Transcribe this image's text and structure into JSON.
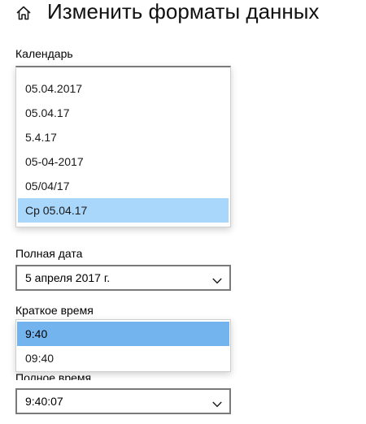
{
  "header": {
    "title": "Изменить форматы данных",
    "home_icon": "home-icon"
  },
  "calendar": {
    "label": "Календарь",
    "options": [
      "05.04.2017",
      "05.04.17",
      "5.4.17",
      "05-04-2017",
      "05/04/17",
      "Ср 05.04.17"
    ],
    "selected_index": 5
  },
  "long_date": {
    "label": "Полная дата",
    "value": "5 апреля 2017 г.",
    "icon": "chevron-down-icon"
  },
  "short_time": {
    "label": "Краткое время",
    "options": [
      "9:40",
      "09:40"
    ],
    "selected_index": 0
  },
  "long_time": {
    "label": "Полное время",
    "value": "9:40:07",
    "icon": "chevron-down-icon"
  },
  "colors": {
    "calendar_highlight": "#a9d6fb",
    "short_time_highlight": "#74b4ee",
    "combobox_border": "#7a7a7a"
  }
}
